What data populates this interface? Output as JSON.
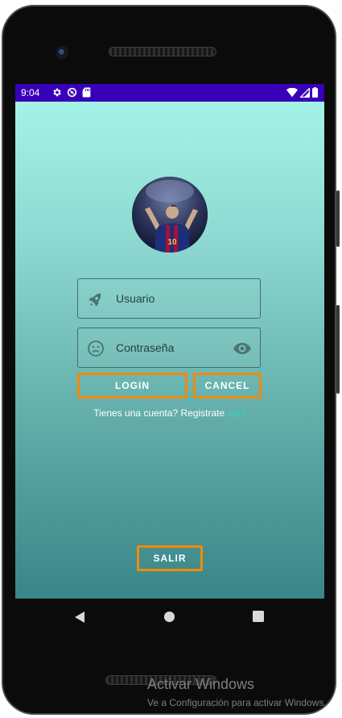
{
  "status_bar": {
    "time": "9:04",
    "background_color": "#3800b8",
    "left_icons": [
      "gear-icon",
      "sync-blocked-icon",
      "sd-card-icon"
    ],
    "right_icons": [
      "wifi-icon",
      "signal-icon",
      "battery-icon"
    ]
  },
  "profile": {
    "avatar_description": "circular profile photo of soccer player number 10"
  },
  "login_form": {
    "username_placeholder": "Usuario",
    "password_placeholder": "Contraseña",
    "login_label": "LOGIN",
    "cancel_label": "CANCEL",
    "register_prompt": "Tienes una cuenta? Registrate",
    "register_link": "aquí",
    "button_border_color": "#f08a0c"
  },
  "exit_label": "SALIR",
  "nav_bar": {
    "icons": [
      "back-icon",
      "home-icon",
      "recents-icon"
    ]
  },
  "watermark": {
    "title": "Activar Windows",
    "subtitle": "Ve a Configuración para activar Windows."
  }
}
